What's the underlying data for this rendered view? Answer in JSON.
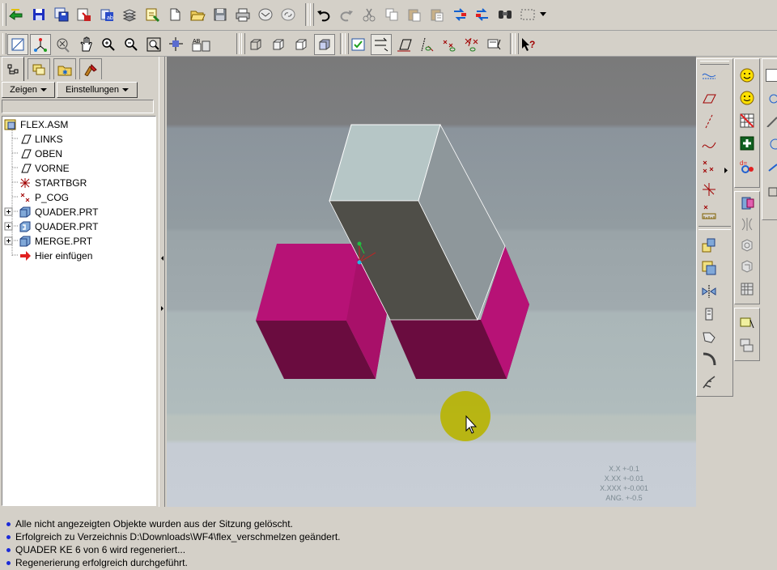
{
  "toolbar_top": {
    "icons": [
      "regenerate-icon",
      "save-icon",
      "save-as-icon",
      "backup-icon",
      "rename-icon",
      "layers-icon",
      "sketch-icon",
      "new-icon",
      "open-icon",
      "save-file-icon",
      "print-icon",
      "email-icon",
      "email-link-icon",
      "undo-icon",
      "redo-icon",
      "cut-icon",
      "copy-icon",
      "paste-icon",
      "paste-special-icon",
      "regen-icon",
      "regen-manager-icon",
      "find-icon",
      "select-box-icon"
    ]
  },
  "toolbar_view": {
    "icons": [
      "plane-display-icon",
      "axis-display-icon",
      "point-display-icon",
      "pan-icon",
      "zoom-in-icon",
      "zoom-out-icon",
      "refit-icon",
      "reorient-icon",
      "saved-views-icon",
      "wireframe-icon",
      "hidden-line-icon",
      "no-hidden-icon",
      "shading-icon",
      "datum-plane-toggle-icon",
      "datum-axis-toggle-icon",
      "datum-point-toggle-icon",
      "csys-toggle-icon",
      "spin-center-icon",
      "annotation-toggle-icon",
      "context-help-icon"
    ]
  },
  "left_panel": {
    "tabs": [
      "model-tree-tab",
      "layer-tab",
      "favorites-tab",
      "properties-tab"
    ],
    "show_label": "Zeigen",
    "settings_label": "Einstellungen",
    "tree": [
      {
        "label": "FLEX.ASM",
        "icon": "assembly-icon",
        "expandable": false,
        "indent": 0
      },
      {
        "label": "LINKS",
        "icon": "datum-plane-icon",
        "expandable": false,
        "indent": 1
      },
      {
        "label": "OBEN",
        "icon": "datum-plane-icon",
        "expandable": false,
        "indent": 1
      },
      {
        "label": "VORNE",
        "icon": "datum-plane-icon",
        "expandable": false,
        "indent": 1
      },
      {
        "label": "STARTBGR",
        "icon": "csys-icon",
        "expandable": false,
        "indent": 1
      },
      {
        "label": "P_COG",
        "icon": "datum-point-icon",
        "expandable": false,
        "indent": 1
      },
      {
        "label": "QUADER.PRT",
        "icon": "part-icon",
        "expandable": true,
        "indent": 1
      },
      {
        "label": "QUADER.PRT",
        "icon": "flex-part-icon",
        "expandable": true,
        "indent": 1
      },
      {
        "label": "MERGE.PRT",
        "icon": "part-icon",
        "expandable": true,
        "indent": 1
      },
      {
        "label": "Hier einfügen",
        "icon": "insert-here-icon",
        "expandable": false,
        "indent": 1
      }
    ]
  },
  "viewport": {
    "tolerances": [
      "X.X +-0.1",
      "X.XX +-0.01",
      "X.XXX +-0.001",
      "ANG. +-0.5"
    ]
  },
  "right_toolbar_datum": {
    "icons": [
      "sketched-curve-icon",
      "datum-plane-tool-icon",
      "datum-axis-tool-icon",
      "datum-curve-tool-icon",
      "datum-point-tool-icon",
      "csys-tool-icon",
      "analysis-feature-icon",
      "component-place-icon",
      "create-component-icon",
      "mirror-component-icon",
      "repeat-component-icon",
      "feature-ops-icon",
      "pattern-icon",
      "sweep-icon"
    ]
  },
  "right_toolbar_extra": {
    "icons": [
      "smiley-icon",
      "smiley-alt-icon",
      "table-icon",
      "add-icon",
      "relations-icon",
      "family-table-icon",
      "flex-icon",
      "hole-icon",
      "round-icon",
      "chamfer-icon",
      "draft-icon",
      "shell-icon"
    ]
  },
  "messages": [
    "Alle nicht angezeigten Objekte wurden aus der Sitzung gelöscht.",
    "Erfolgreich zu Verzeichnis D:\\Downloads\\WF4\\flex_verschmelzen geändert.",
    "QUADER KE 6 von 6 wird regeneriert...",
    "Regenerierung erfolgreich durchgeführt."
  ]
}
